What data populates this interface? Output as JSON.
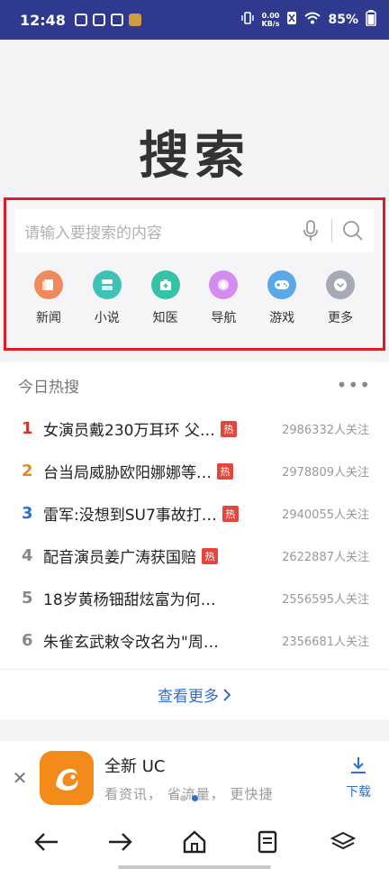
{
  "status_bar": {
    "time": "12:48",
    "speed_value": "0.00",
    "speed_unit": "KB/s",
    "battery": "85%"
  },
  "hero": {
    "title": "搜索"
  },
  "search": {
    "placeholder": "请输入要搜索的内容",
    "highlight_color": "#e01e22"
  },
  "shortcuts": [
    {
      "label": "新闻",
      "icon": "news-icon",
      "color": "#f08a5d"
    },
    {
      "label": "小说",
      "icon": "novel-icon",
      "color": "#3ec2b5"
    },
    {
      "label": "知医",
      "icon": "medical-icon",
      "color": "#35c3a8"
    },
    {
      "label": "导航",
      "icon": "navigation-icon",
      "color": "#d48cf0"
    },
    {
      "label": "游戏",
      "icon": "gamepad-icon",
      "color": "#5aa8e8"
    },
    {
      "label": "更多",
      "icon": "more-icon",
      "color": "#a7a9b4"
    }
  ],
  "hot": {
    "title": "今日热搜",
    "more_label": "查看更多",
    "items": [
      {
        "rank": "1",
        "text": "女演员戴230万耳环 父…",
        "badge": "热",
        "count": "2986332人关注"
      },
      {
        "rank": "2",
        "text": "台当局威胁欧阳娜娜等…",
        "badge": "热",
        "count": "2978809人关注"
      },
      {
        "rank": "3",
        "text": "雷军:没想到SU7事故打…",
        "badge": "热",
        "count": "2940055人关注"
      },
      {
        "rank": "4",
        "text": "配音演员姜广涛获国赔",
        "badge": "热",
        "count": "2622887人关注"
      },
      {
        "rank": "5",
        "text": "18岁黄杨钿甜炫富为何…",
        "badge": "",
        "count": "2556595人关注"
      },
      {
        "rank": "6",
        "text": "朱雀玄武敕令改名为\"周…",
        "badge": "",
        "count": "2356681人关注"
      }
    ]
  },
  "banner": {
    "title": "全新 UC",
    "subtitle": "看资讯，  省流量，  更快捷",
    "download_label": "下载",
    "brand_color": "#f28b1a"
  }
}
